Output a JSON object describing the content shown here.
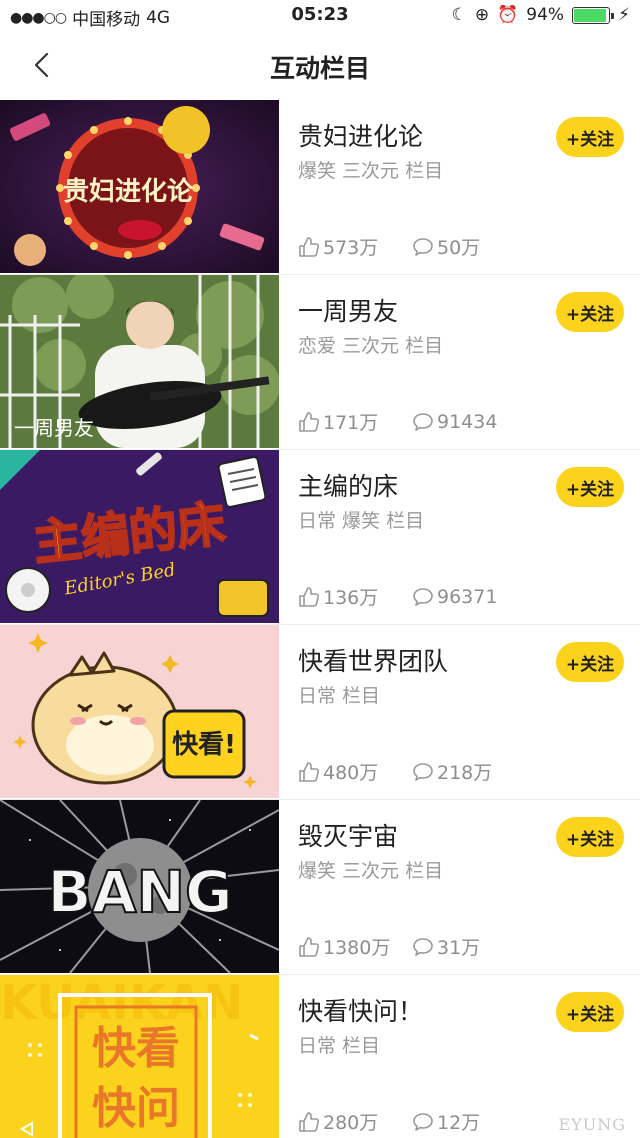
{
  "status_bar": {
    "carrier": "中国移动",
    "network": "4G",
    "time": "05:23",
    "battery_percent": "94%",
    "battery_level": 0.94
  },
  "nav": {
    "title": "互动栏目",
    "back_icon": "chevron-left-icon"
  },
  "follow_label": "+关注",
  "rows": [
    {
      "title": "贵妇进化论",
      "tags": "爆笑 三次元 栏目",
      "likes": "573万",
      "comments": "50万"
    },
    {
      "title": "一周男友",
      "tags": "恋爱 三次元 栏目",
      "likes": "171万",
      "comments": "91434"
    },
    {
      "title": "主编的床",
      "tags": "日常 爆笑 栏目",
      "likes": "136万",
      "comments": "96371"
    },
    {
      "title": "快看世界团队",
      "tags": "日常 栏目",
      "likes": "480万",
      "comments": "218万"
    },
    {
      "title": "毁灭宇宙",
      "tags": "爆笑 三次元 栏目",
      "likes": "1380万",
      "comments": "31万"
    },
    {
      "title": "快看快问！",
      "tags": "日常 栏目",
      "likes": "280万",
      "comments": "12万"
    }
  ],
  "thumb_text": {
    "t0": "贵妇进化论",
    "t1": "一周男友",
    "t2": "主编的床",
    "t2_sub": "Editor's Bed",
    "t3": "快看!",
    "t4": "BANG",
    "t5_bg": "KUAIKAN",
    "t5_a": "快看",
    "t5_b": "快问"
  },
  "watermark": "EYUNG",
  "colors": {
    "accent": "#fcd31c",
    "tag_gray": "#9a9a9a"
  }
}
